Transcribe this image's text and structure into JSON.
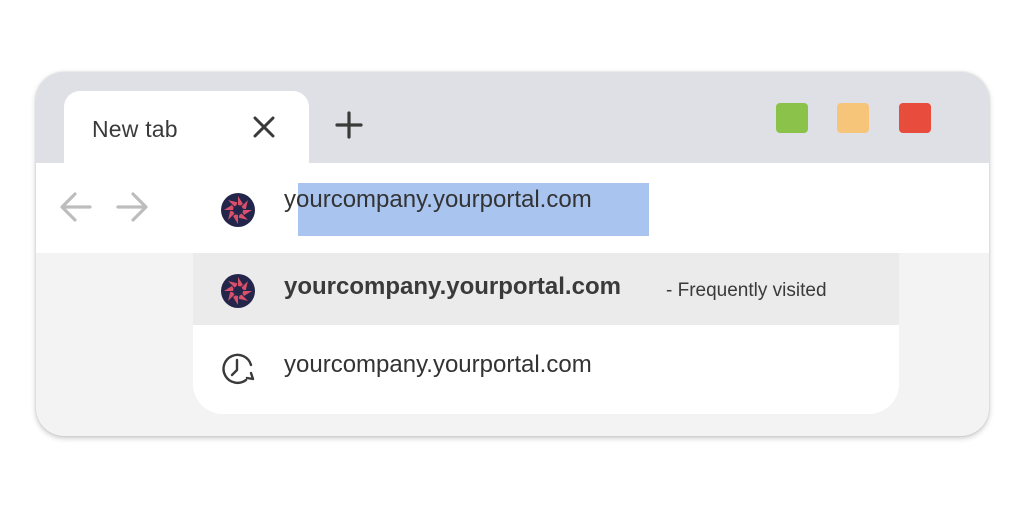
{
  "tab": {
    "title": "New tab"
  },
  "window_controls": {
    "colors": [
      "#8bc34a",
      "#f6c57a",
      "#e84c3d"
    ]
  },
  "address_bar": {
    "value": "yourcompany.yourportal.com",
    "selected_text": "ourcompany.yourportal.com"
  },
  "suggestions": [
    {
      "text": "yourcompany.yourportal.com",
      "hint": "- Frequently visited",
      "icon": "site-favicon-icon"
    },
    {
      "text": "yourcompany.yourportal.com",
      "icon": "history-clock-icon"
    }
  ]
}
